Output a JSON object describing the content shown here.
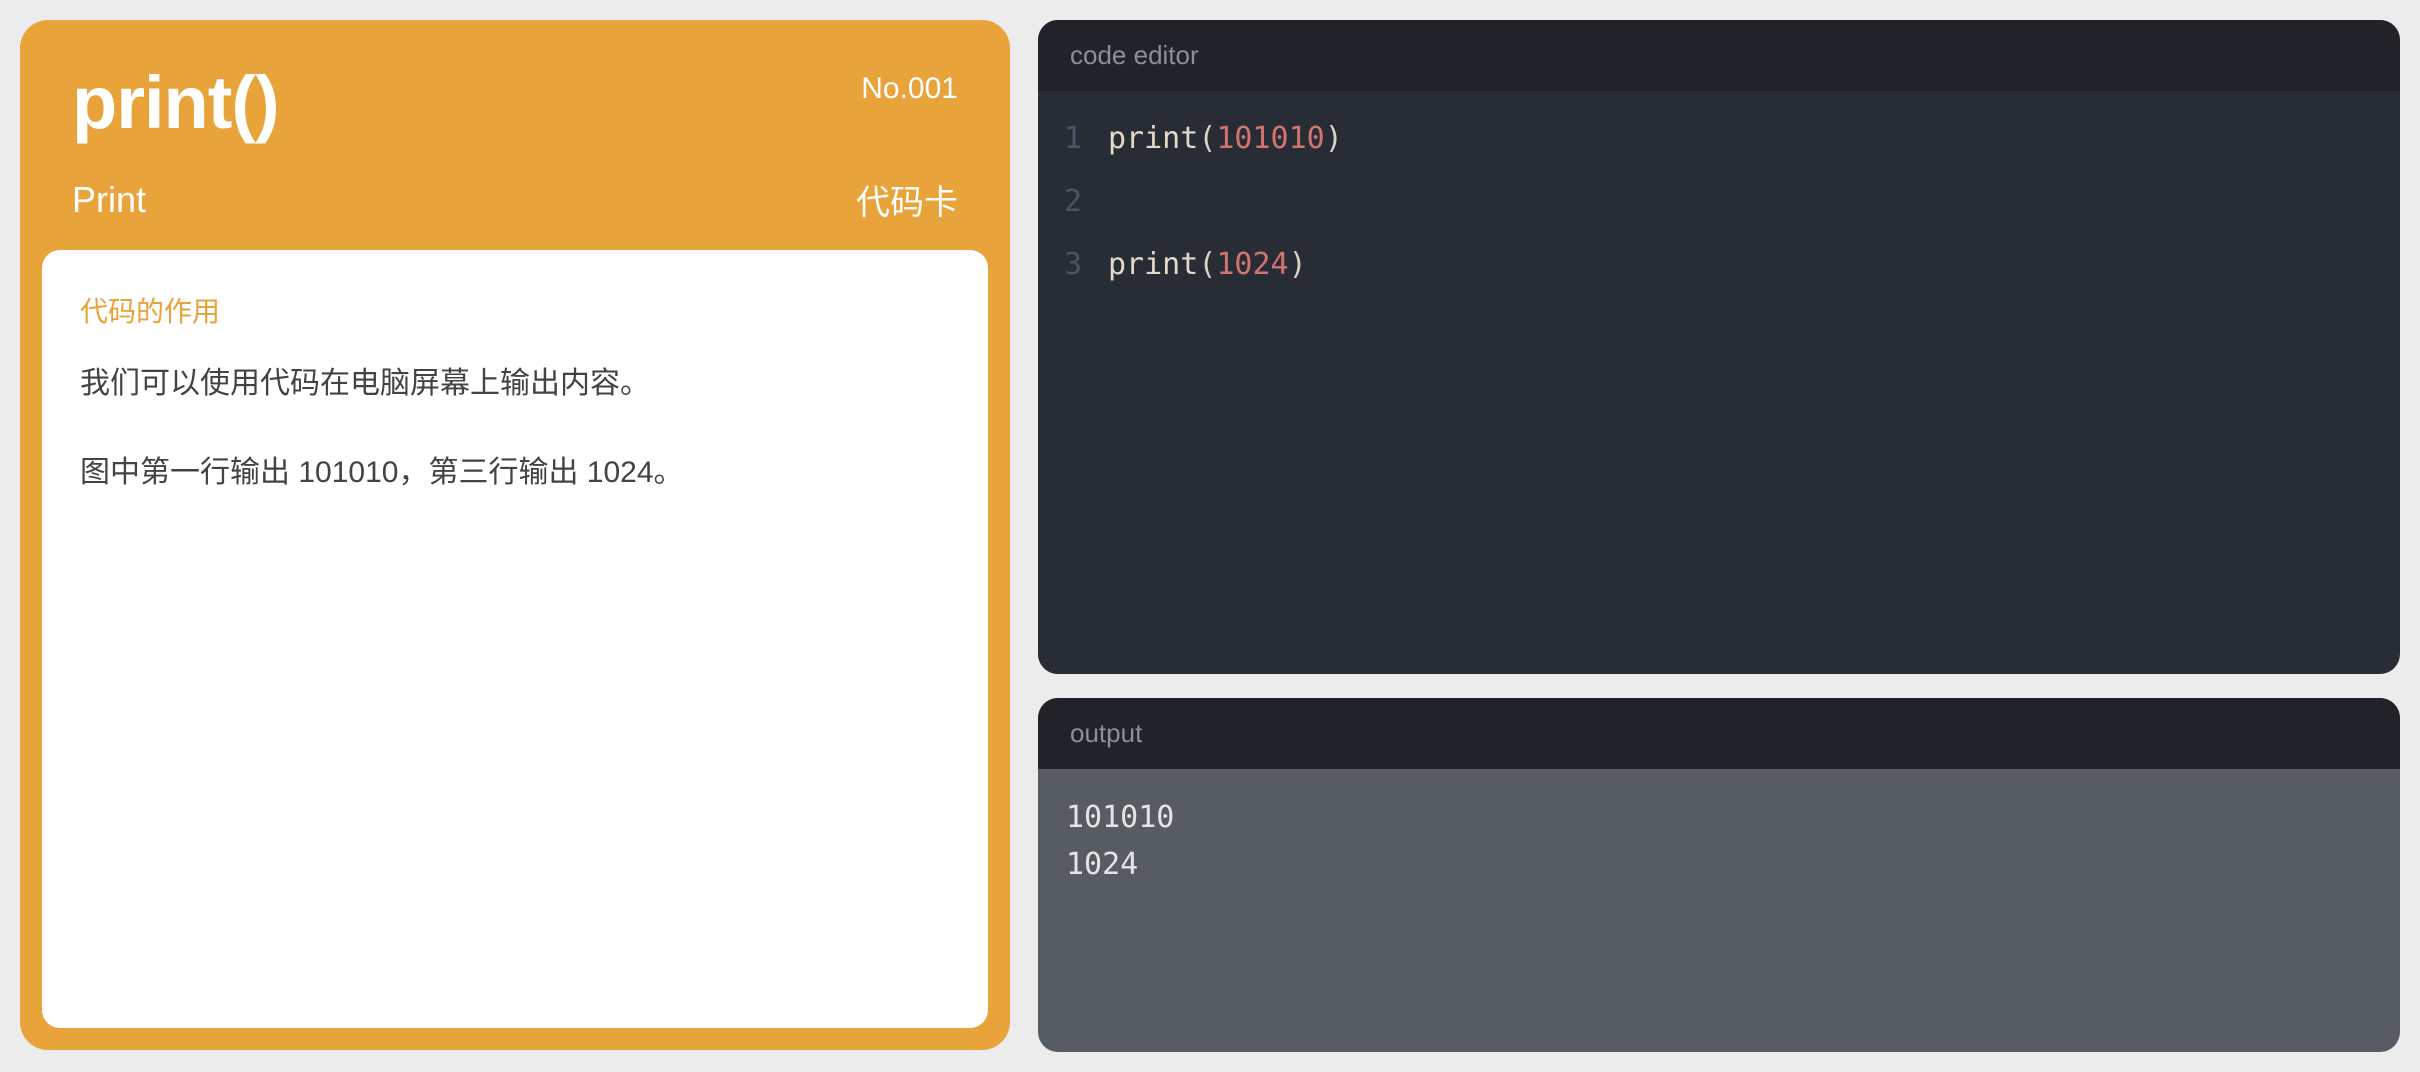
{
  "card": {
    "title": "print()",
    "number": "No.001",
    "subtitle": "Print",
    "type": "代码卡",
    "section_title": "代码的作用",
    "paragraphs": [
      "我们可以使用代码在电脑屏幕上输出内容。",
      "图中第一行输出 101010，第三行输出 1024。"
    ]
  },
  "editor": {
    "header": "code editor",
    "lines": [
      {
        "n": "1",
        "tokens": [
          {
            "t": "fn",
            "v": "print"
          },
          {
            "t": "paren",
            "v": "("
          },
          {
            "t": "num",
            "v": "101010"
          },
          {
            "t": "paren",
            "v": ")"
          }
        ]
      },
      {
        "n": "2",
        "tokens": []
      },
      {
        "n": "3",
        "tokens": [
          {
            "t": "fn",
            "v": "print"
          },
          {
            "t": "paren",
            "v": "("
          },
          {
            "t": "num",
            "v": "1024"
          },
          {
            "t": "paren",
            "v": ")"
          }
        ]
      }
    ]
  },
  "output": {
    "header": "output",
    "lines": [
      "101010",
      "1024"
    ]
  }
}
